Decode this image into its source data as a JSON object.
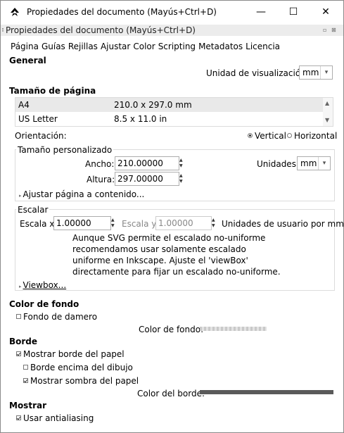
{
  "window": {
    "title": "Propiedades del documento (Mayús+Ctrl+D)",
    "minimize": "—",
    "maximize": "☐",
    "close": "✕"
  },
  "dock": {
    "title": "Propiedades del documento (Mayús+Ctrl+D)",
    "btn1": "▫",
    "btn2": "⊠"
  },
  "tabs": [
    "Página",
    "Guías",
    "Rejillas",
    "Ajustar",
    "Color",
    "Scripting",
    "Metadatos",
    "Licencia"
  ],
  "general": {
    "heading": "General",
    "display_units_label": "Unidad de visualización:",
    "display_units_value": "mm"
  },
  "page_size": {
    "heading": "Tamaño de página",
    "rows": [
      {
        "name": "A4",
        "size": "210.0 x 297.0 mm"
      },
      {
        "name": "US Letter",
        "size": "8.5 x 11.0 in"
      }
    ],
    "orientation_label": "Orientación:",
    "vertical": "Vertical",
    "horizontal": "Horizontal",
    "orientation_selected": "Vertical"
  },
  "custom_size": {
    "legend": "Tamaño personalizado",
    "width_label": "Ancho:",
    "width_value": "210.00000",
    "height_label": "Altura:",
    "height_value": "297.00000",
    "units_label": "Unidades:",
    "units_value": "mm",
    "fit_label": "Ajustar página a contenido..."
  },
  "scale": {
    "legend": "Escalar",
    "scale_x_label": "Escala x:",
    "scale_x_value": "1.00000",
    "scale_y_label": "Escala y:",
    "scale_y_value": "1.00000",
    "units_text": "Unidades de usuario por mm.",
    "note": "Aunque SVG permite el escalado no-uniforme recomendamos usar solamente escalado uniforme en Inkscape. Ajuste el 'viewBox' directamente para fijar un escalado no-uniforme.",
    "viewbox_label": "Viewbox..."
  },
  "background": {
    "heading": "Color de fondo",
    "checkerboard_label": "Fondo de damero",
    "checkerboard_checked": false,
    "color_label": "Color de fondo:"
  },
  "border": {
    "heading": "Borde",
    "show_border_label": "Mostrar borde del papel",
    "show_border_checked": true,
    "border_on_top_label": "Borde encima del dibujo",
    "border_on_top_checked": false,
    "show_shadow_label": "Mostrar sombra del papel",
    "show_shadow_checked": true,
    "color_label": "Color del borde:",
    "color": "#5a5a5a"
  },
  "display": {
    "heading": "Mostrar",
    "antialias_label": "Usar antialiasing",
    "antialias_checked": true
  }
}
